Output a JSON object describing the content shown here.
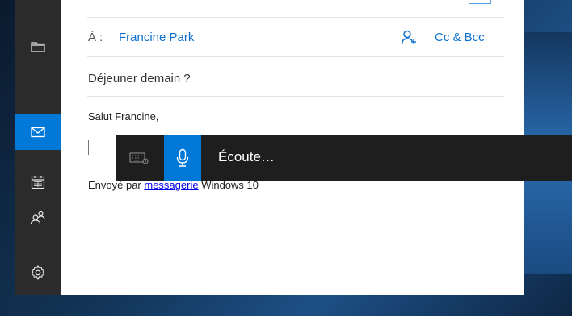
{
  "sidebar": {
    "items": [
      {
        "icon": "folder-icon",
        "active": false
      },
      {
        "icon": "mail-icon",
        "active": true
      },
      {
        "icon": "calendar-icon",
        "active": false
      },
      {
        "icon": "people-icon",
        "active": false
      },
      {
        "icon": "settings-gear-icon",
        "active": false
      }
    ]
  },
  "compose": {
    "to_label": "À :",
    "to_name": "Francine Park",
    "cc_bcc": "Cc & Bcc",
    "subject": "Déjeuner demain ?",
    "greeting": "Salut Francine,",
    "signature_prefix": "Envoyé par ",
    "signature_link": "messagerie",
    "signature_suffix": " Windows 10"
  },
  "dictation": {
    "status": "Écoute…"
  },
  "colors": {
    "accent": "#0078d7",
    "link": "#0a6fcf",
    "sidebar_bg": "#2b2b2b",
    "toolbar_bg": "#1e1e1e"
  }
}
